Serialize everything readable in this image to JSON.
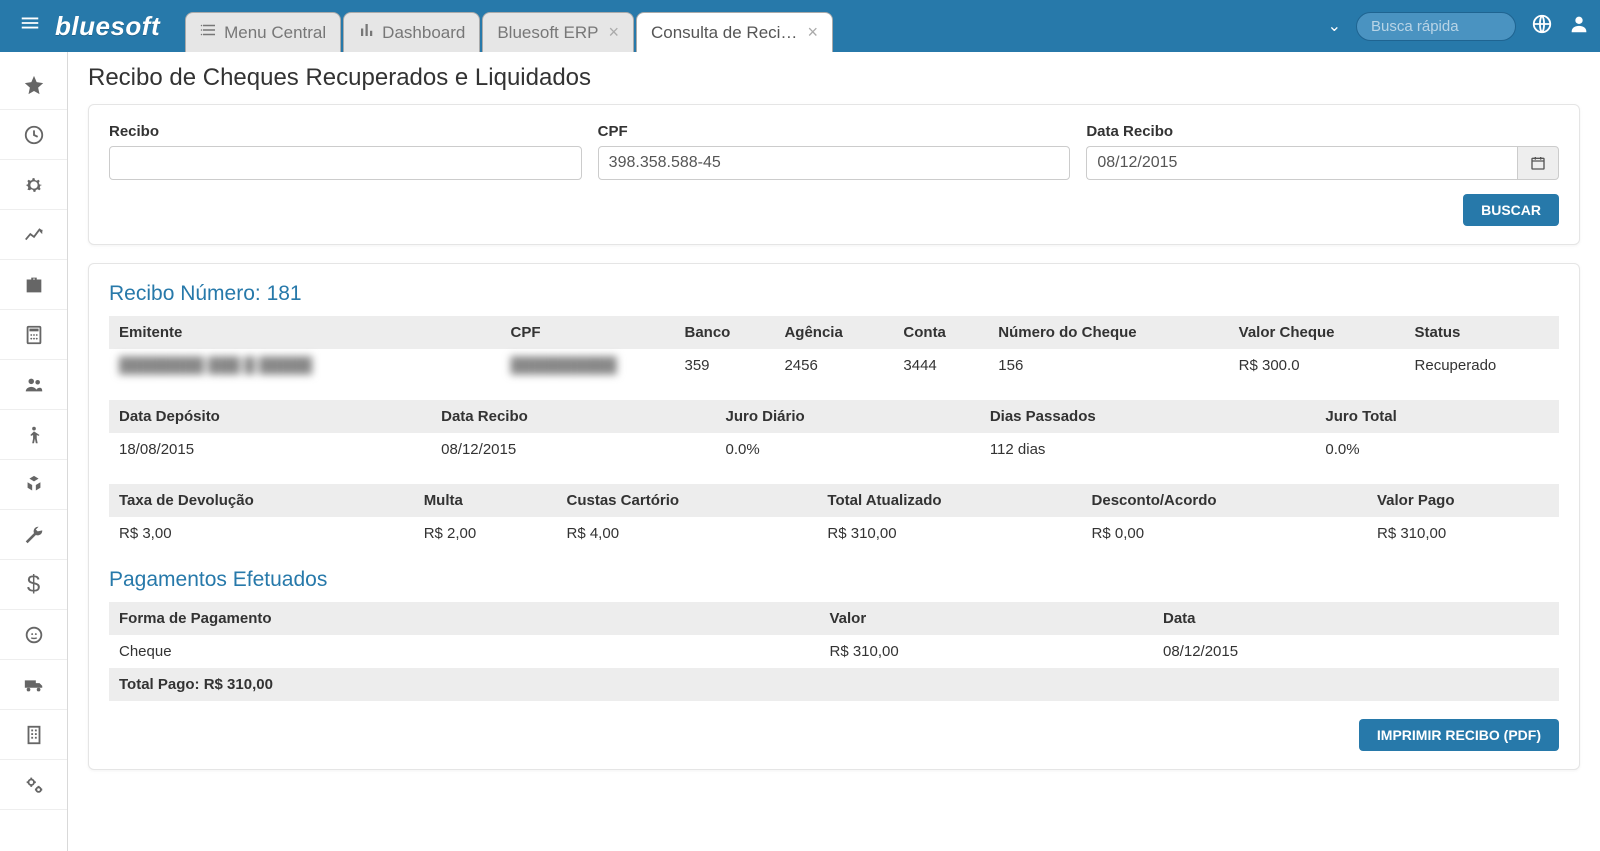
{
  "header": {
    "logo": "bluesoft",
    "tabs": [
      {
        "label": "Menu Central",
        "icon": "menu-list-icon",
        "closable": false
      },
      {
        "label": "Dashboard",
        "icon": "bar-chart-icon",
        "closable": false
      },
      {
        "label": "Bluesoft ERP",
        "icon": "",
        "closable": true
      },
      {
        "label": "Consulta de Reci…",
        "icon": "",
        "closable": true,
        "active": true
      }
    ],
    "search_placeholder": "Busca rápida"
  },
  "sidebar": {
    "items": [
      "star-icon",
      "clock-icon",
      "gear-icon",
      "line-chart-icon",
      "briefcase-icon",
      "calculator-icon",
      "users-icon",
      "person-icon",
      "cubes-icon",
      "wrench-icon",
      "dollar-icon",
      "lion-icon",
      "truck-icon",
      "building-icon",
      "cogs-icon"
    ]
  },
  "page": {
    "title": "Recibo de Cheques Recuperados e Liquidados"
  },
  "searchForm": {
    "recibo_label": "Recibo",
    "recibo_value": "",
    "cpf_label": "CPF",
    "cpf_value": "398.358.588-45",
    "data_label": "Data Recibo",
    "data_value": "08/12/2015",
    "buscar_label": "BUSCAR"
  },
  "recibo": {
    "heading_prefix": "Recibo Número: ",
    "numero": "181",
    "headers1": [
      "Emitente",
      "CPF",
      "Banco",
      "Agência",
      "Conta",
      "Número do Cheque",
      "Valor Cheque",
      "Status"
    ],
    "row1": [
      "████████ ███ █ █████",
      "██████████",
      "359",
      "2456",
      "3444",
      "156",
      "R$ 300.0",
      "Recuperado"
    ],
    "headers2": [
      "Data Depósito",
      "Data Recibo",
      "Juro Diário",
      "Dias Passados",
      "Juro Total"
    ],
    "row2": [
      "18/08/2015",
      "08/12/2015",
      "0.0%",
      "112 dias",
      "0.0%"
    ],
    "headers3": [
      "Taxa de Devolução",
      "Multa",
      "Custas Cartório",
      "Total Atualizado",
      "Desconto/Acordo",
      "Valor Pago"
    ],
    "row3": [
      "R$ 3,00",
      "R$ 2,00",
      "R$ 4,00",
      "R$ 310,00",
      "R$ 0,00",
      "R$ 310,00"
    ]
  },
  "pagamentos": {
    "heading": "Pagamentos Efetuados",
    "headers": [
      "Forma de Pagamento",
      "Valor",
      "Data"
    ],
    "row": [
      "Cheque",
      "R$ 310,00",
      "08/12/2015"
    ],
    "total_label": "Total Pago: R$ 310,00"
  },
  "footer": {
    "imprimir_label": "IMPRIMIR RECIBO (PDF)"
  }
}
